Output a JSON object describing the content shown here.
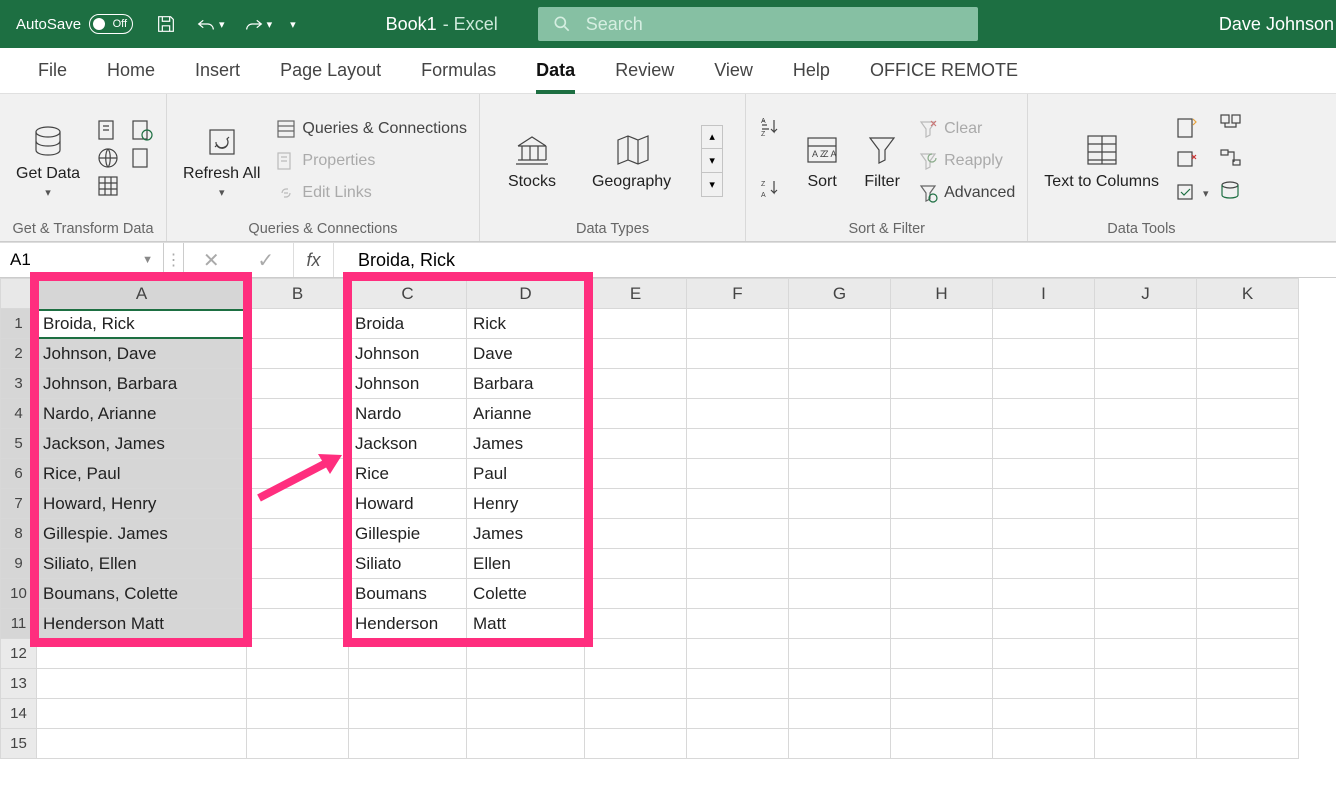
{
  "title_bar": {
    "autosave_label": "AutoSave",
    "autosave_state": "Off",
    "book_name": "Book1",
    "product_suffix": "-  Excel",
    "search_placeholder": "Search",
    "user_name": "Dave Johnson"
  },
  "tabs": [
    "File",
    "Home",
    "Insert",
    "Page Layout",
    "Formulas",
    "Data",
    "Review",
    "View",
    "Help",
    "OFFICE REMOTE"
  ],
  "active_tab": "Data",
  "ribbon": {
    "get_transform": {
      "get_data": "Get\nData",
      "label": "Get & Transform Data"
    },
    "queries": {
      "refresh": "Refresh\nAll",
      "qc": "Queries & Connections",
      "props": "Properties",
      "links": "Edit Links",
      "label": "Queries & Connections"
    },
    "types": {
      "stocks": "Stocks",
      "geo": "Geography",
      "label": "Data Types"
    },
    "sort_filter": {
      "sort": "Sort",
      "filter": "Filter",
      "clear": "Clear",
      "reapply": "Reapply",
      "advanced": "Advanced",
      "label": "Sort & Filter"
    },
    "tools": {
      "t2c": "Text to\nColumns",
      "label": "Data Tools"
    }
  },
  "formula_bar": {
    "name_box": "A1",
    "content": "Broida, Rick"
  },
  "columns": [
    "A",
    "B",
    "C",
    "D",
    "E",
    "F",
    "G",
    "H",
    "I",
    "J",
    "K"
  ],
  "rows": [
    {
      "a": "Broida, Rick",
      "c": "Broida",
      "d": "Rick"
    },
    {
      "a": "Johnson, Dave",
      "c": "Johnson",
      "d": "Dave"
    },
    {
      "a": "Johnson, Barbara",
      "c": "Johnson",
      "d": "Barbara"
    },
    {
      "a": "Nardo, Arianne",
      "c": "Nardo",
      "d": "Arianne"
    },
    {
      "a": "Jackson, James",
      "c": "Jackson",
      "d": "James"
    },
    {
      "a": "Rice, Paul",
      "c": "Rice",
      "d": "Paul"
    },
    {
      "a": "Howard, Henry",
      "c": "Howard",
      "d": "Henry"
    },
    {
      "a": "Gillespie. James",
      "c": "Gillespie",
      "d": "James"
    },
    {
      "a": "Siliato, Ellen",
      "c": "Siliato",
      "d": "Ellen"
    },
    {
      "a": "Boumans, Colette",
      "c": "Boumans",
      "d": "Colette"
    },
    {
      "a": "Henderson Matt",
      "c": "Henderson",
      "d": "Matt"
    }
  ],
  "total_rows_shown": 15
}
